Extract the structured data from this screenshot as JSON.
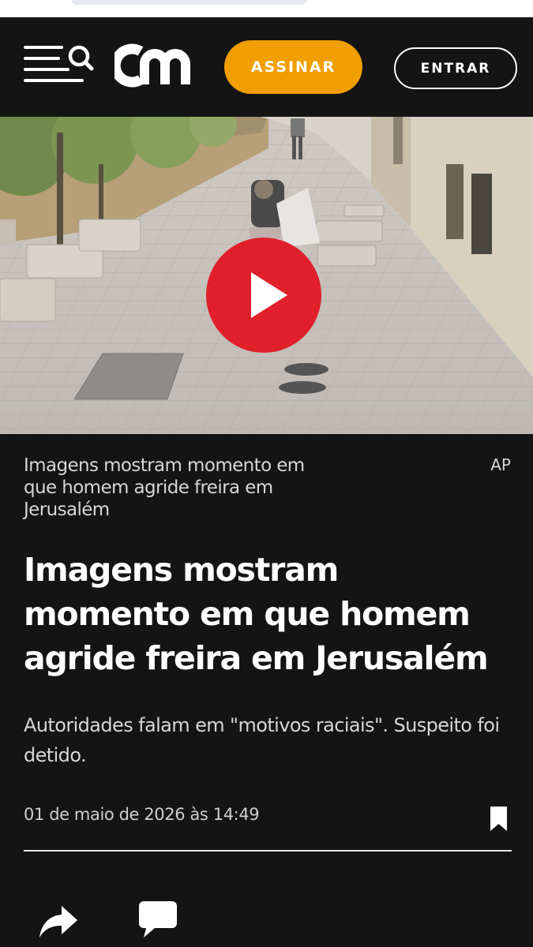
{
  "header": {
    "logo_text": "cm",
    "subscribe_label": "ASSINAR",
    "login_label": "ENTRAR",
    "menu_icon": "menu-icon",
    "search_icon": "search-icon",
    "accent_color": "#f09e00"
  },
  "video": {
    "play_icon": "play-icon",
    "play_color": "#e0202b"
  },
  "article": {
    "caption": "Imagens mostram momento em que homem agride freira em Jerusalém",
    "credit": "AP",
    "headline": "Imagens mostram momento em que homem agride freira em Jerusalém",
    "lead": "Autoridades falam em \"motivos raciais\". Suspeito foi detido.",
    "date": "01 de maio de 2026 às 14:49",
    "bookmark_icon": "bookmark-icon",
    "share_icon": "share-icon",
    "comment_icon": "comment-icon"
  }
}
